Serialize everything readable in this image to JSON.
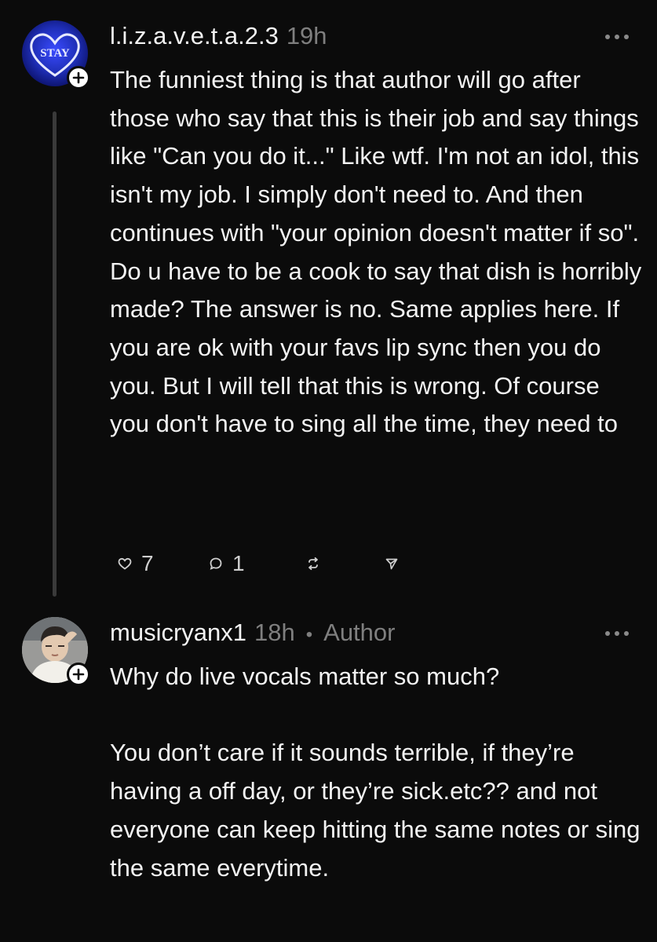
{
  "comments": [
    {
      "username": "l.i.z.a.v.e.t.a.2.3",
      "time": "19h",
      "avatar_text": "STAY",
      "text": "The funniest thing is that author will go after those who say that this is their job and say things like \"Can you do it...\" Like wtf. I'm not an idol, this isn't my job. I simply don't need to. And then continues with \"your opinion doesn't matter if so\". Do u have to be a cook to say that dish is horribly made? The answer is no. Same applies here. If you are ok with your favs lip sync then you do you. But I will tell that this is wrong. Of course you don't have to sing all the time, they need to",
      "likes": "7",
      "replies": "1"
    },
    {
      "username": "musicryanx1",
      "time": "18h",
      "author_label": "Author",
      "text": "Why do live vocals matter so much?\n\nYou don’t care if it sounds terrible, if they’re having a off day, or they’re sick.etc?? and not everyone can keep hitting the same notes or sing the same everytime."
    }
  ],
  "icons": {
    "like": "heart-icon",
    "reply": "comment-icon",
    "repost": "repost-icon",
    "share": "send-icon",
    "more": "more-horizontal-icon",
    "follow": "plus-icon"
  }
}
